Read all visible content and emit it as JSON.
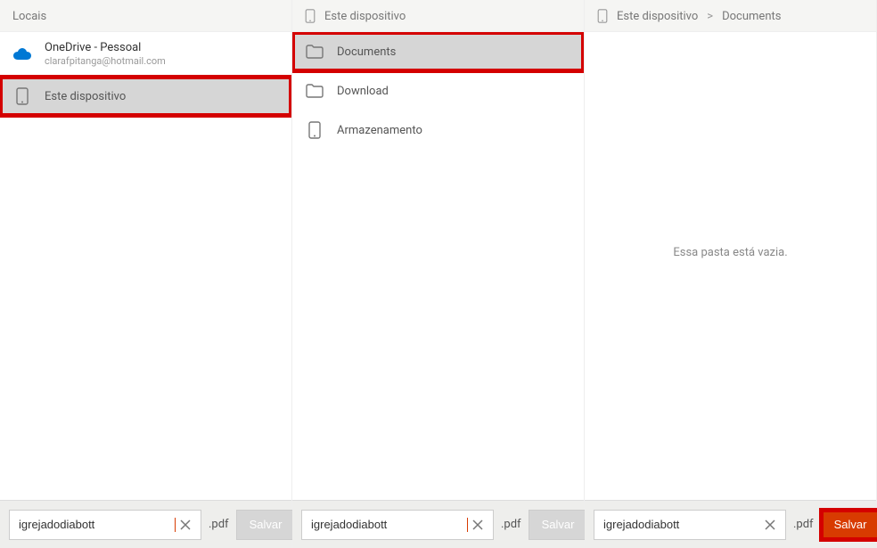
{
  "panel1": {
    "header": "Locais",
    "onedrive": {
      "title": "OneDrive - Pessoal",
      "email": "clarafpitanga@hotmail.com"
    },
    "device": {
      "label": "Este dispositivo"
    }
  },
  "panel2": {
    "header_label": "Este dispositivo",
    "items": [
      {
        "label": "Documents"
      },
      {
        "label": "Download"
      },
      {
        "label": "Armazenamento"
      }
    ]
  },
  "panel3": {
    "crumb_device": "Este dispositivo",
    "crumb_sep": ">",
    "crumb_folder": "Documents",
    "empty_text": "Essa pasta está vazia."
  },
  "bottom": {
    "filename": "igrejadodiabott",
    "extension": ".pdf",
    "save_label": "Salvar"
  },
  "colors": {
    "accent": "#d83b01",
    "highlight": "#d40000"
  }
}
